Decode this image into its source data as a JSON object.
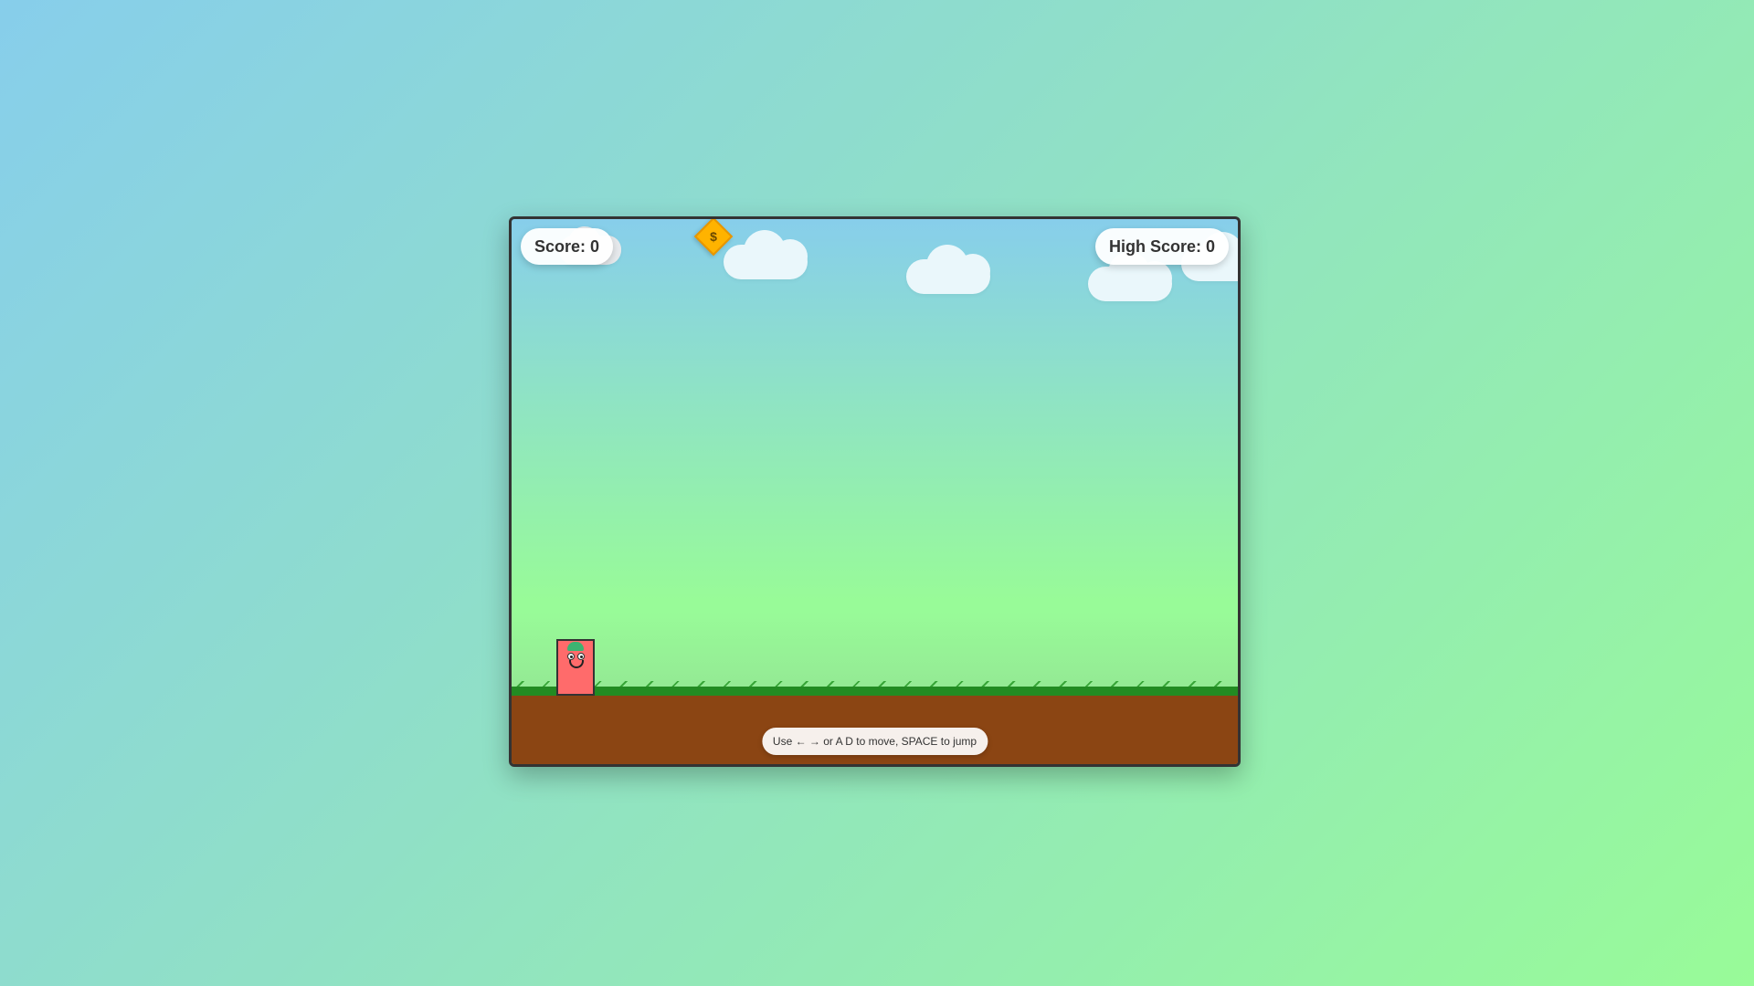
{
  "hud": {
    "score_label": "Score: 0",
    "high_score_label": "High Score: 0"
  },
  "coin": {
    "glyph": "$",
    "icon": "coin-icon"
  },
  "instructions": {
    "text": "Use ← → or A D to move, SPACE to jump"
  },
  "colors": {
    "sky_top": "#87ceeb",
    "sky_bottom": "#98fb98",
    "grass": "#228b22",
    "dirt": "#8b4513",
    "player": "#ff6b6b",
    "coin": "#ffb300"
  }
}
